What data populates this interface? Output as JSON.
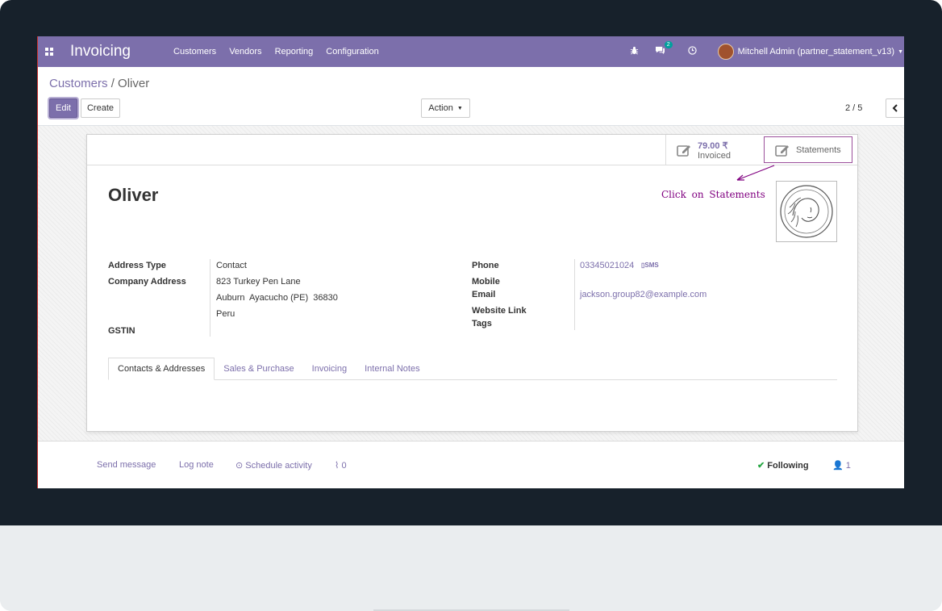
{
  "navbar": {
    "app_title": "Invoicing",
    "menu": [
      "Customers",
      "Vendors",
      "Reporting",
      "Configuration"
    ],
    "messages_badge": "2",
    "user": "Mitchell Admin (partner_statement_v13)",
    "accent": "#7c6fab"
  },
  "breadcrumb": {
    "parent": "Customers",
    "separator": "/",
    "current": "Oliver"
  },
  "control": {
    "edit": "Edit",
    "create": "Create",
    "action": "Action",
    "pager": "2 / 5"
  },
  "stat_buttons": {
    "invoiced_value": "79.00 ₹",
    "invoiced_label": "Invoiced",
    "statements_label": "Statements"
  },
  "annotation": "Click on Statements",
  "record": {
    "name": "Oliver",
    "left_fields": {
      "address_type_label": "Address Type",
      "address_type": "Contact",
      "company_address_label": "Company Address",
      "street": "823 Turkey Pen Lane",
      "city_line": "Auburn  Ayacucho (PE)  36830",
      "country": "Peru",
      "gstin_label": "GSTIN"
    },
    "right_fields": {
      "phone_label": "Phone",
      "phone": "03345021024",
      "sms": "SMS",
      "mobile_label": "Mobile",
      "email_label": "Email",
      "email": "jackson.group82@example.com",
      "website_label": "Website Link",
      "tags_label": "Tags"
    }
  },
  "tabs": [
    "Contacts & Addresses",
    "Sales & Purchase",
    "Invoicing",
    "Internal Notes"
  ],
  "chatter": {
    "send_message": "Send message",
    "log_note": "Log note",
    "schedule_activity": "Schedule activity",
    "attachments": "0",
    "following": "Following",
    "followers": "1"
  }
}
